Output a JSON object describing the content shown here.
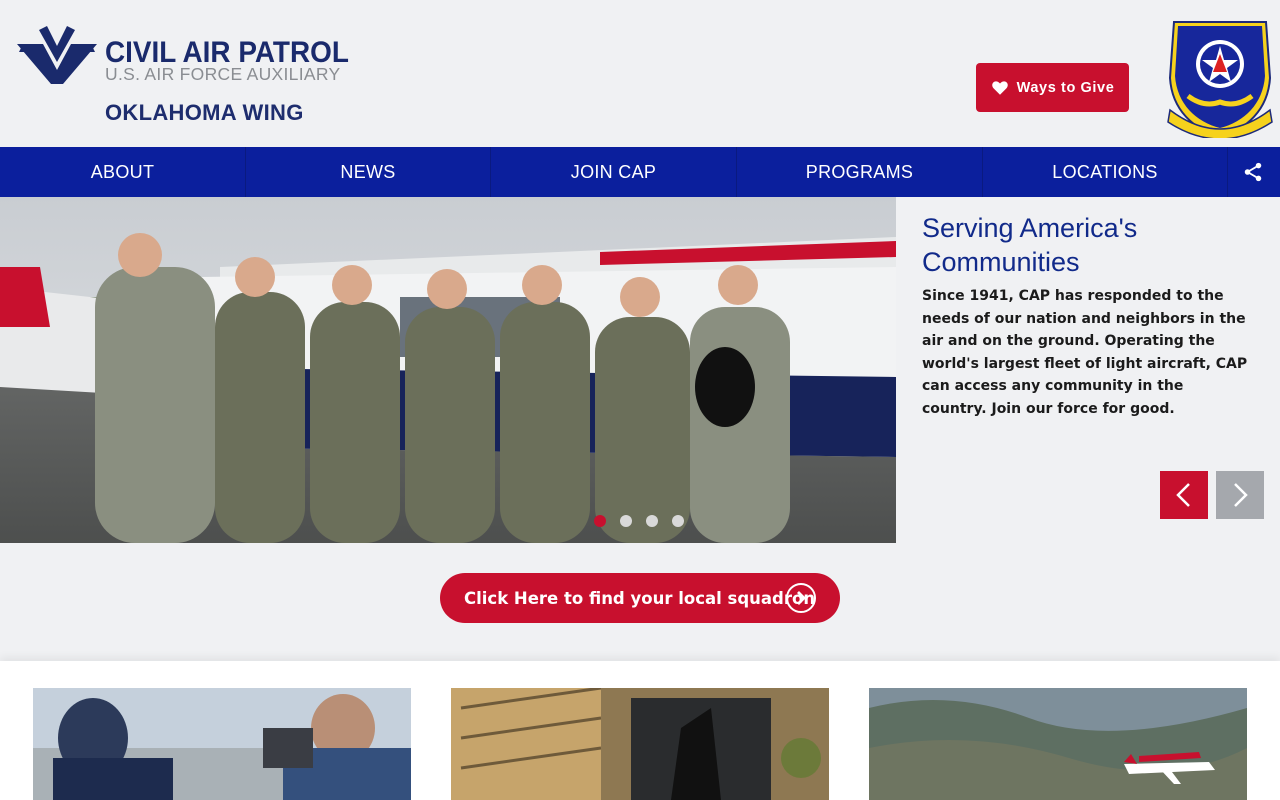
{
  "header": {
    "logo_line1": "CIVIL AIR PATROL",
    "logo_line2": "U.S. AIR FORCE AUXILIARY",
    "wing_title": "OKLAHOMA WING",
    "give_label": "Ways to Give",
    "crest_text": "OKLAHOMA WING"
  },
  "nav": {
    "items": [
      {
        "label": "ABOUT"
      },
      {
        "label": "NEWS"
      },
      {
        "label": "JOIN CAP"
      },
      {
        "label": "PROGRAMS"
      },
      {
        "label": "LOCATIONS"
      }
    ],
    "share_icon": "share-icon"
  },
  "hero": {
    "title": "Serving America's Communities",
    "body": "Since 1941, CAP has responded to the needs of our nation and neighbors in the air and on the ground. Operating the world's largest fleet of light aircraft, CAP can access any community in the country. Join our force for good.",
    "slide_count": 4,
    "active_slide": 1,
    "prev_icon": "chevron-left-icon",
    "next_icon": "chevron-right-icon"
  },
  "cta": {
    "label": "Click Here to find your local squadron",
    "icon": "chevron-right-circle-icon"
  },
  "colors": {
    "brand_blue": "#0b1f9d",
    "brand_red": "#c8102e",
    "navy_text": "#1e2d6e"
  }
}
